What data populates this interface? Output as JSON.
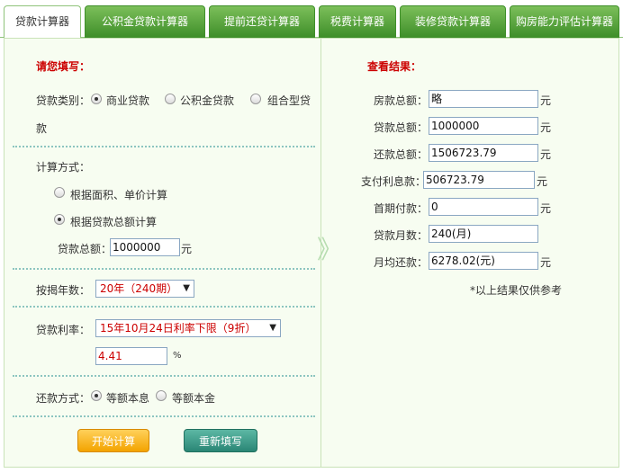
{
  "tabs": [
    {
      "label": "贷款计算器",
      "active": true
    },
    {
      "label": "公积金贷款计算器"
    },
    {
      "label": "提前还贷计算器"
    },
    {
      "label": "税费计算器"
    },
    {
      "label": "装修贷款计算器"
    },
    {
      "label": "购房能力评估计算器"
    }
  ],
  "left": {
    "title": "请您填写：",
    "loan_type_label": "贷款类别：",
    "loan_types": [
      "商业贷款",
      "公积金贷款",
      "组合型贷"
    ],
    "loan_type_wrap": "款",
    "calc_method_label": "计算方式：",
    "calc_methods": [
      "根据面积、单价计算",
      "根据贷款总额计算"
    ],
    "loan_total_label": "贷款总额：",
    "loan_total_value": "1000000",
    "unit_yuan": "元",
    "years_label": "按揭年数：",
    "years_value": "20年（240期）",
    "rate_label": "贷款利率：",
    "rate_select": "15年10月24日利率下限（9折）",
    "rate_value": "4.41",
    "rate_unit": "%",
    "repay_label": "还款方式：",
    "repay_methods": [
      "等额本息",
      "等额本金"
    ],
    "start_button": "开始计算",
    "reset_button": "重新填写"
  },
  "right": {
    "title": "查看结果：",
    "rows": [
      {
        "label": "房款总额：",
        "value": "略",
        "unit": "元"
      },
      {
        "label": "贷款总额：",
        "value": "1000000",
        "unit": "元"
      },
      {
        "label": "还款总额：",
        "value": "1506723.79",
        "unit": "元"
      },
      {
        "label": "支付利息款：",
        "value": "506723.79",
        "unit": "元"
      },
      {
        "label": "首期付款：",
        "value": "0",
        "unit": "元"
      },
      {
        "label": "贷款月数：",
        "value": "240(月)",
        "unit": ""
      },
      {
        "label": "月均还款：",
        "value": "6278.02(元)",
        "unit": "元"
      }
    ],
    "note": "*以上结果仅供参考"
  }
}
